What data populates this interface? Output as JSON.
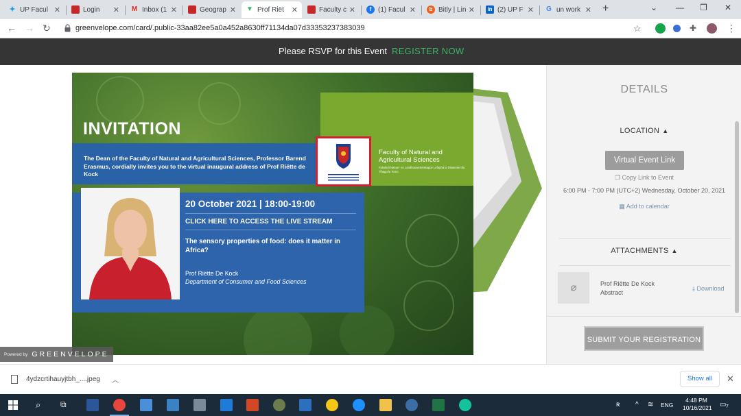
{
  "browser": {
    "tabs": [
      {
        "title": "UP Facul",
        "icon": "twitter-icon",
        "color": "#1d9bf0"
      },
      {
        "title": "Login",
        "icon": "up-crest-icon",
        "color": "#c62828"
      },
      {
        "title": "Inbox (1",
        "icon": "gmail-icon",
        "color": "#d93025"
      },
      {
        "title": "Geograp",
        "icon": "up-crest-icon",
        "color": "#c62828"
      },
      {
        "title": "Prof Riët",
        "icon": "greenvelope-icon",
        "color": "#3fb568",
        "active": true
      },
      {
        "title": "Faculty c",
        "icon": "up-crest-icon",
        "color": "#c62828"
      },
      {
        "title": "(1) Facul",
        "icon": "facebook-icon",
        "color": "#1877f2"
      },
      {
        "title": "Bitly | Lin",
        "icon": "bitly-icon",
        "color": "#ee6123"
      },
      {
        "title": "(2) UP F",
        "icon": "linkedin-icon",
        "color": "#0a66c2"
      },
      {
        "title": "un work",
        "icon": "google-icon",
        "color": "#5f6368"
      }
    ],
    "new_tab": "+",
    "url": "greenvelope.com/card/.public-33aa82ee5a0a452a8630ff71134da07d33353237383039"
  },
  "rsvp": {
    "text": "Please RSVP for this Event",
    "link": "REGISTER NOW",
    "link_color": "#3fb568"
  },
  "invitation": {
    "title": "INVITATION",
    "intro": "The Dean of the Faculty of Natural and Agricultural Sciences, Professor Barend Erasmus, cordially invites you to the virtual inaugural address of Prof Riëtte de Kock",
    "faculty_name": "Faculty of Natural and Agricultural Sciences",
    "faculty_af": "Fakulteit Natuur- en Landbouwetenskappe Lefapha la Disaense tša Tlhago le Temo",
    "date": "20 October 2021 | 18:00-19:00",
    "stream_link": "CLICK HERE TO ACCESS THE LIVE STREAM",
    "talk_title": "The sensory properties of food: does it matter in Africa?",
    "speaker": "Prof Riëtte De Kock",
    "department": "Department of Consumer and Food Sciences"
  },
  "powered": {
    "by": "Powered by",
    "brand": "GREENVELOPE"
  },
  "details": {
    "title": "DETAILS",
    "location_heading": "LOCATION",
    "virtual_button": "Virtual Event Link",
    "copy_link": "Copy Link to Event",
    "time": "6:00 PM - 7:00 PM (UTC+2) Wednesday, October 20, 2021",
    "add_calendar": "Add to calendar",
    "attachments_heading": "ATTACHMENTS",
    "attachment_name": "Prof Riëtte De Kock Abstract",
    "download": "Download",
    "submit": "SUBMIT YOUR REGISTRATION"
  },
  "downloads": {
    "file_name": "4ydzcrtihauyjtbh_....jpeg",
    "show_all": "Show all"
  },
  "taskbar": {
    "lang": "ENG",
    "time": "4:48 PM",
    "date": "10/16/2021",
    "notifications": "7"
  }
}
